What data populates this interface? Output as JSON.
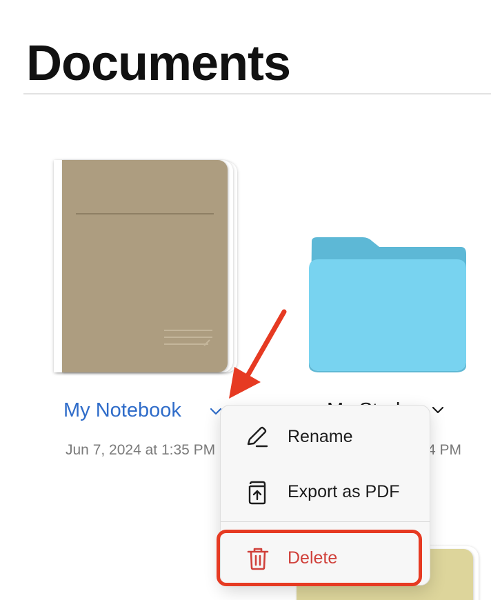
{
  "page": {
    "title": "Documents"
  },
  "items": [
    {
      "name": "My Notebook",
      "date": "Jun 7, 2024 at 1:35 PM",
      "kind": "notebook",
      "cover_color": "#ad9d80"
    },
    {
      "name": "My Study",
      "date_visible_fragment": "4 PM",
      "kind": "folder",
      "folder_color": "#78d3f0"
    },
    {
      "kind": "notebook",
      "cover_color": "#ddd59b"
    }
  ],
  "context_menu": {
    "items": [
      {
        "label": "Rename",
        "icon": "pencil-icon"
      },
      {
        "label": "Export as PDF",
        "icon": "export-pdf-icon"
      },
      {
        "label": "Delete",
        "icon": "trash-icon",
        "destructive": true
      }
    ]
  },
  "colors": {
    "accent": "#2f6cc9",
    "destructive": "#d0403a",
    "annotation": "#e63a22"
  }
}
